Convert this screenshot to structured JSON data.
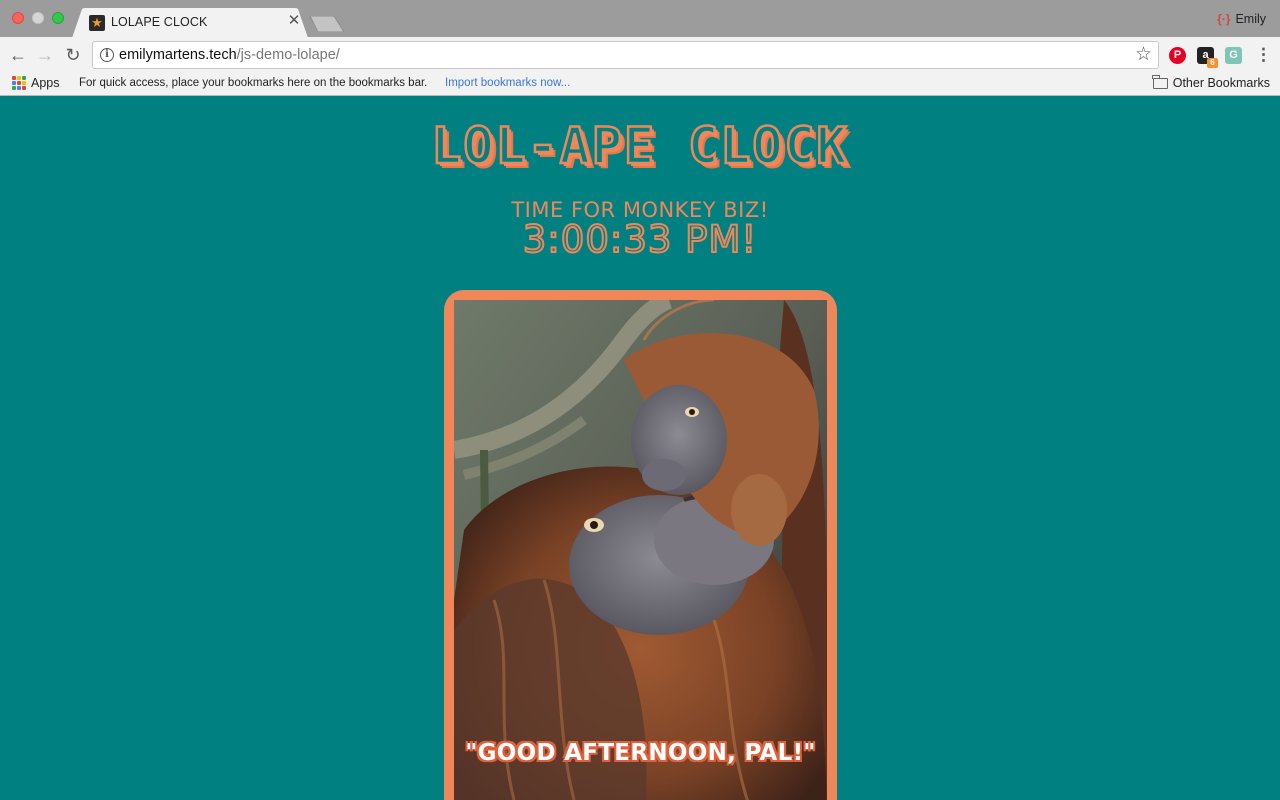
{
  "browser": {
    "tab_title": "LOLAPE CLOCK",
    "profile_name": "Emily",
    "url_host": "emilymartens.tech",
    "url_path": "/js-demo-lolape/",
    "bookmarks": {
      "apps_label": "Apps",
      "hint": "For quick access, place your bookmarks here on the bookmarks bar.",
      "import_link": "Import bookmarks now...",
      "other": "Other Bookmarks"
    },
    "extension_badge": "6"
  },
  "page": {
    "title": "LOL-APE CLOCK",
    "tagline": "TIME FOR MONKEY BIZ!",
    "time": "3:00:33 PM!",
    "caption": "\"GOOD AFTERNOON, PAL!\""
  },
  "colors": {
    "background": "#008080",
    "accent": "#f0875a"
  }
}
